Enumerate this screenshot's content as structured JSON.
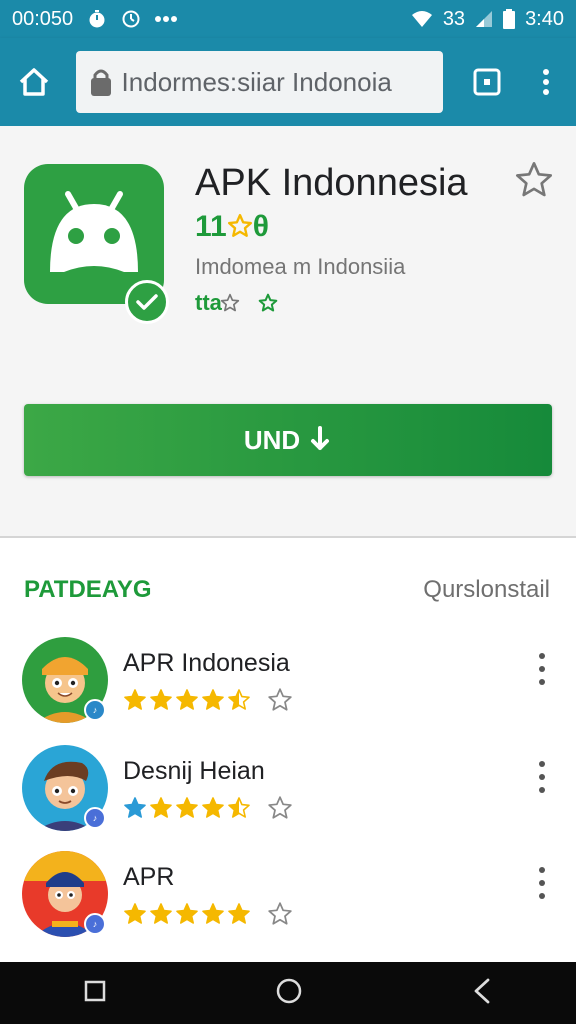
{
  "status_bar": {
    "time_left": "00:050",
    "signal_text": "33",
    "clock": "3:40",
    "icons": [
      "timer-icon",
      "alarm-icon",
      "more-notifications-icon",
      "wifi-icon",
      "signal-icon",
      "battery-icon"
    ]
  },
  "toolbar": {
    "url": "Indormes:siiar Indonoia",
    "icons": [
      "home-icon",
      "lock-icon",
      "tabs-icon",
      "menu-icon"
    ]
  },
  "app": {
    "title": "APK Indonnesia",
    "rating": "11",
    "rating_suffix": "θ",
    "subtitle": "Imdomea m Indonsiia",
    "tag_text": "tta",
    "install_label": "UND",
    "colors": {
      "accent": "#1e9a3a",
      "toolbar": "#1b8aa9",
      "star": "#f5b800"
    }
  },
  "section": {
    "title": "PATDEAYG",
    "link": "Qurslonstail"
  },
  "items": [
    {
      "name": "APR Indonesia",
      "rating": 4.5
    },
    {
      "name": "Desnij Heian",
      "rating": 4.5
    },
    {
      "name": "APR",
      "rating": 5
    }
  ],
  "navbar": {
    "icons": [
      "recents-icon",
      "home-circle-icon",
      "back-icon"
    ]
  }
}
